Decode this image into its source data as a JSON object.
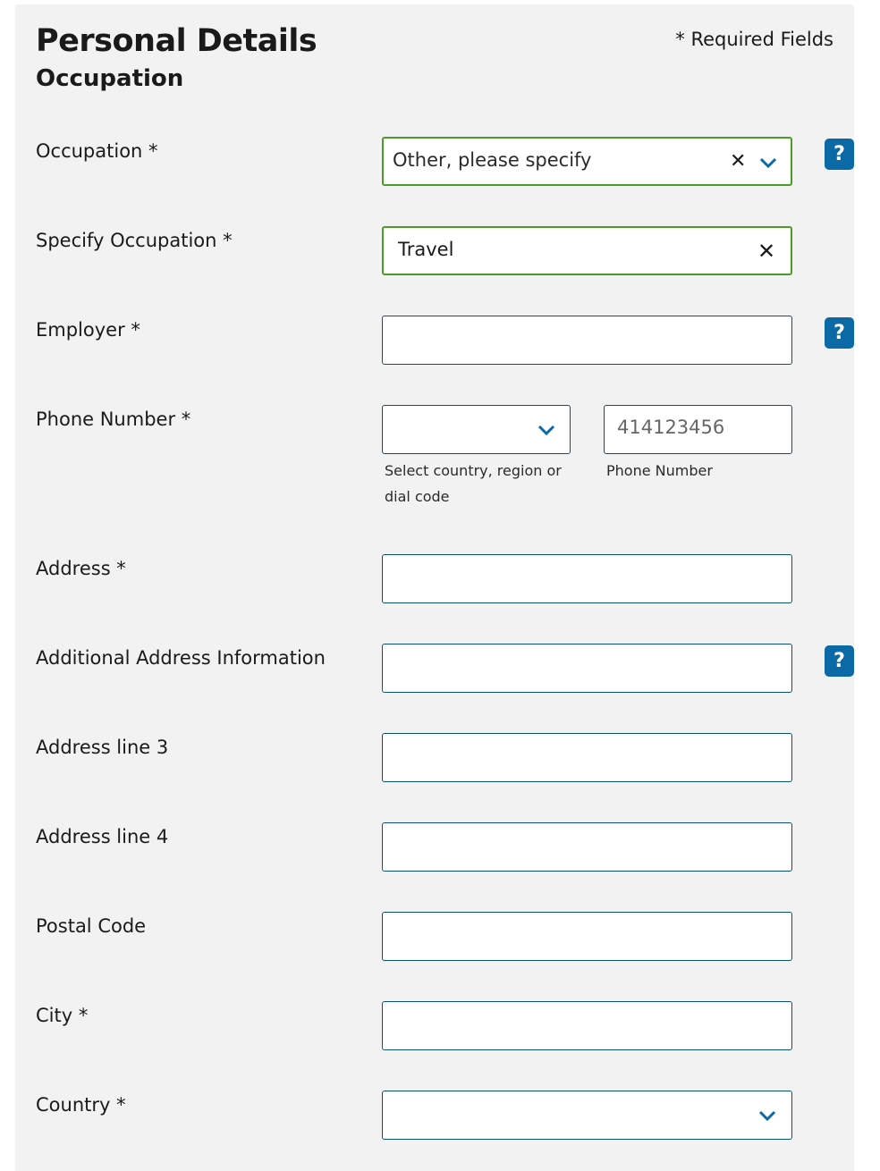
{
  "header": {
    "title": "Personal Details",
    "subtitle": "Occupation",
    "required_note": "* Required Fields"
  },
  "fields": {
    "occupation": {
      "label": "Occupation *",
      "value": "Other, please specify",
      "help": "?"
    },
    "specify_occupation": {
      "label": "Specify Occupation *",
      "value": "Travel"
    },
    "employer": {
      "label": "Employer *",
      "value": "",
      "help": "?"
    },
    "phone": {
      "label": "Phone Number *",
      "country_value": "",
      "country_hint": "Select country, region or dial code",
      "number_placeholder": "414123456",
      "number_hint": "Phone Number"
    },
    "address": {
      "label": "Address *",
      "value": ""
    },
    "additional_address": {
      "label": "Additional Address Information",
      "value": "",
      "help": "?"
    },
    "address_line_3": {
      "label": "Address line 3",
      "value": ""
    },
    "address_line_4": {
      "label": "Address line 4",
      "value": ""
    },
    "postal_code": {
      "label": "Postal Code",
      "value": ""
    },
    "city": {
      "label": "City *",
      "value": ""
    },
    "country": {
      "label": "Country *",
      "value": ""
    }
  },
  "colors": {
    "accent": "#0b6aa6",
    "valid_border": "#4b9a2a",
    "field_border": "#0d4f73",
    "panel_bg": "#f2f2f2"
  },
  "icons": {
    "clear": "close-icon",
    "dropdown": "chevron-down-icon",
    "help": "help-icon"
  }
}
